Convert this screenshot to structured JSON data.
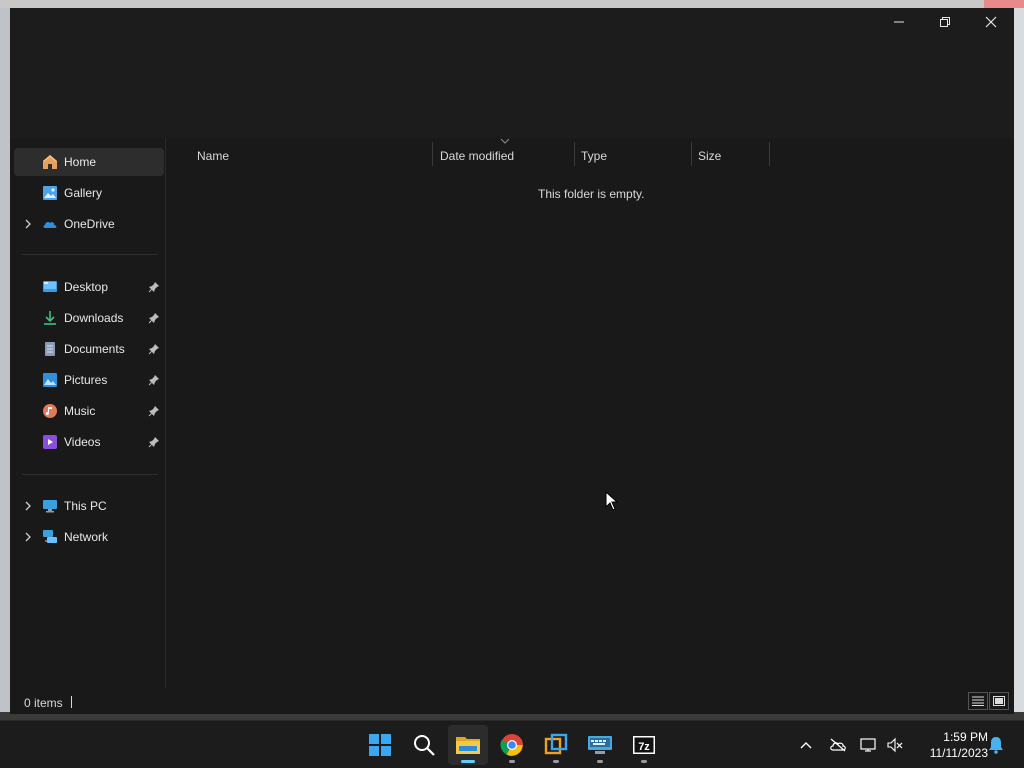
{
  "window": {
    "controls": {
      "minimize": "minimize",
      "maximize": "restore",
      "close": "close"
    }
  },
  "nav": {
    "top": [
      {
        "label": "Home",
        "icon": "home-icon",
        "selected": true,
        "expandable": false
      },
      {
        "label": "Gallery",
        "icon": "gallery-icon",
        "selected": false,
        "expandable": false
      },
      {
        "label": "OneDrive",
        "icon": "onedrive-icon",
        "selected": false,
        "expandable": true
      }
    ],
    "quick_access": [
      {
        "label": "Desktop",
        "icon": "desktop-icon",
        "pinned": true
      },
      {
        "label": "Downloads",
        "icon": "downloads-icon",
        "pinned": true
      },
      {
        "label": "Documents",
        "icon": "documents-icon",
        "pinned": true
      },
      {
        "label": "Pictures",
        "icon": "pictures-icon",
        "pinned": true
      },
      {
        "label": "Music",
        "icon": "music-icon",
        "pinned": true
      },
      {
        "label": "Videos",
        "icon": "videos-icon",
        "pinned": true
      }
    ],
    "bottom": [
      {
        "label": "This PC",
        "icon": "this-pc-icon",
        "expandable": true
      },
      {
        "label": "Network",
        "icon": "network-icon",
        "expandable": true
      }
    ]
  },
  "content": {
    "columns": {
      "name": "Name",
      "date_modified": "Date modified",
      "type": "Type",
      "size": "Size"
    },
    "empty_message": "This folder is empty."
  },
  "status": {
    "item_count": "0 items"
  },
  "taskbar": {
    "apps": [
      "start-icon",
      "search-icon",
      "file-explorer-icon",
      "chrome-icon",
      "vmware-icon",
      "keyboard-app-icon",
      "7zip-icon"
    ],
    "sevenzip_label": "7z",
    "clock": {
      "time": "1:59 PM",
      "date": "11/11/2023"
    }
  },
  "colors": {
    "accent": "#60cdff",
    "folder": "#f0c030",
    "window_bg": "#191919"
  }
}
